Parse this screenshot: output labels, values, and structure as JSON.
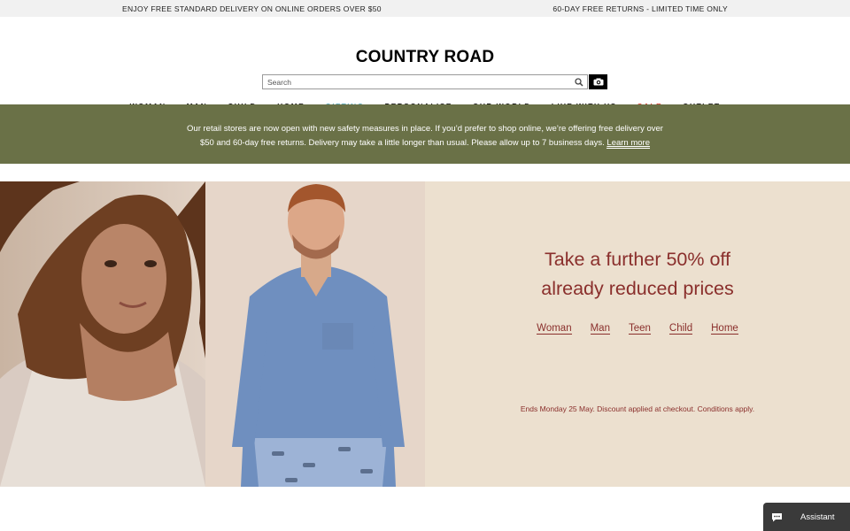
{
  "topbar": {
    "left_text": "ENJOY FREE STANDARD DELIVERY ON ONLINE ORDERS OVER $50",
    "right_text": "60-DAY FREE RETURNS - LIMITED TIME ONLY"
  },
  "header": {
    "logo": "COUNTRY ROAD",
    "search_placeholder": "Search"
  },
  "nav": {
    "items": [
      {
        "label": "WOMAN",
        "color": "#111111"
      },
      {
        "label": "MAN",
        "color": "#111111"
      },
      {
        "label": "CHILD",
        "color": "#111111"
      },
      {
        "label": "HOME",
        "color": "#111111"
      },
      {
        "label": "GIFTING",
        "color": "#5aa7b6"
      },
      {
        "label": "PERSONALISE",
        "color": "#111111"
      },
      {
        "label": "OUR WORLD",
        "color": "#111111"
      },
      {
        "label": "LIVE WITH US",
        "color": "#111111"
      },
      {
        "label": "SALE",
        "color": "#d43b2e"
      },
      {
        "label": "OUTLET",
        "color": "#111111"
      }
    ]
  },
  "notice": {
    "line1": "Our retail stores are now open with new safety measures in place. If you’d prefer to shop online, we’re offering free delivery over",
    "line2": "$50 and 60-day free returns. Delivery may take a little longer than usual. Please allow up to 7 business days.",
    "link": "Learn more",
    "bg_color": "#6a7147"
  },
  "promo": {
    "title_line1": "Take a further 50% off",
    "title_line2": "already reduced prices",
    "links": [
      "Woman",
      "Man",
      "Teen",
      "Child",
      "Home"
    ],
    "footnote": "Ends Monday 25 May. Discount applied at checkout. Conditions apply.",
    "text_color": "#8a2f2c",
    "bg_color": "#ece0cf"
  },
  "assistant": {
    "label": "Assistant",
    "icon": "chat-bubble-icon"
  },
  "icons": {
    "search": "magnifier-icon",
    "camera": "camera-icon"
  }
}
